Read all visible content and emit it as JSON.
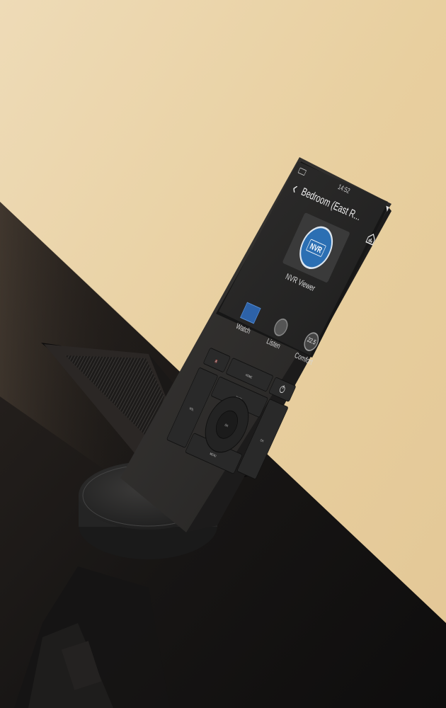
{
  "screen": {
    "status_time": "14:52",
    "room_title": "Bedroom (East R...",
    "tile_logo_text": "NVR",
    "tile_label": "NVR Viewer",
    "activities": [
      {
        "label": "Watch",
        "icon": "tv-icon"
      },
      {
        "label": "Listen",
        "icon": "speaker-icon"
      },
      {
        "label": "Comfort",
        "icon": "thermostat-icon",
        "value": "22.5"
      }
    ],
    "icons": {
      "back": "back-arrow-icon",
      "home": "home-icon",
      "wifi": "wifi-icon",
      "battery": "battery-icon"
    }
  },
  "buttons": {
    "home": "HOME",
    "back": "BACK",
    "ok": "OK",
    "vol": "VOL",
    "ch": "CH",
    "menu": "MENU"
  },
  "colors": {
    "wall": "#ead3a8",
    "desk": "#1b1918",
    "remote_body": "#2f2f2f",
    "screen_background": "#262626",
    "watch_accent": "#2d62a8"
  }
}
